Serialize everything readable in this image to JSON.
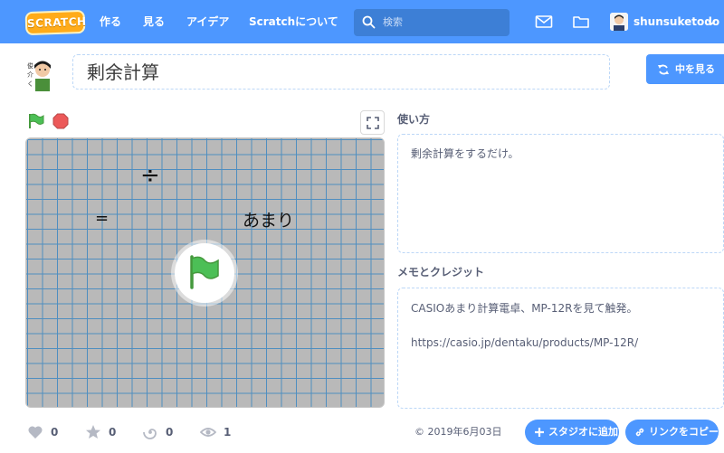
{
  "nav": {
    "logo": "SCRATCH",
    "links": [
      "作る",
      "見る",
      "アイデア",
      "Scratchについて"
    ],
    "search_placeholder": "検索",
    "username": "shunsuketodo"
  },
  "project": {
    "title": "剰余計算",
    "see_inside": "中を見る"
  },
  "stage": {
    "divide_symbol": "÷",
    "equals_symbol": "=",
    "remainder_label": "あまり"
  },
  "instructions": {
    "label": "使い方",
    "text": "剰余計算をするだけ。"
  },
  "notes": {
    "label": "メモとクレジット",
    "line1": "CASIOあまり計算電卓、MP-12Rを見て触発。",
    "line2": "https://casio.jp/dentaku/products/MP-12R/"
  },
  "stats": {
    "loves": "0",
    "favorites": "0",
    "remixes": "0",
    "views": "1"
  },
  "footer": {
    "date": "© 2019年6月03日",
    "add_to_studio": "スタジオに追加",
    "copy_link": "リンクをコピー"
  },
  "colors": {
    "brand_blue": "#4d97ff",
    "flag_green": "#4cbf56",
    "stop_red": "#ec5959"
  }
}
